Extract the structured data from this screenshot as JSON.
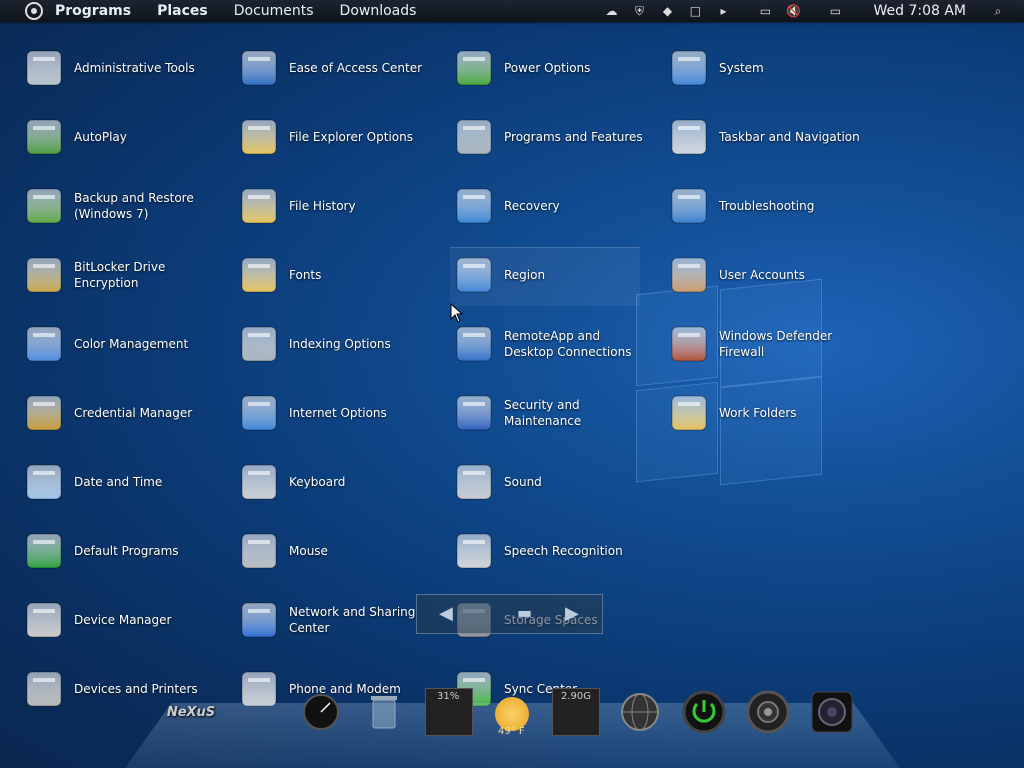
{
  "topbar": {
    "menus": [
      "Programs",
      "Places",
      "Documents",
      "Downloads"
    ],
    "clock": "Wed 7:08 AM"
  },
  "items": [
    {
      "label": "Administrative Tools",
      "icon": "admin-tools-icon"
    },
    {
      "label": "AutoPlay",
      "icon": "autoplay-icon"
    },
    {
      "label": "Backup and Restore\n(Windows 7)",
      "icon": "backup-restore-icon"
    },
    {
      "label": "BitLocker Drive\nEncryption",
      "icon": "bitlocker-icon"
    },
    {
      "label": "Color Management",
      "icon": "color-management-icon"
    },
    {
      "label": "Credential Manager",
      "icon": "credential-manager-icon"
    },
    {
      "label": "Date and Time",
      "icon": "date-time-icon"
    },
    {
      "label": "Default Programs",
      "icon": "default-programs-icon"
    },
    {
      "label": "Device Manager",
      "icon": "device-manager-icon"
    },
    {
      "label": "Devices and Printers",
      "icon": "devices-printers-icon"
    },
    {
      "label": "Ease of Access Center",
      "icon": "ease-of-access-icon"
    },
    {
      "label": "File Explorer Options",
      "icon": "file-explorer-options-icon"
    },
    {
      "label": "File History",
      "icon": "file-history-icon"
    },
    {
      "label": "Fonts",
      "icon": "fonts-icon"
    },
    {
      "label": "Indexing Options",
      "icon": "indexing-options-icon"
    },
    {
      "label": "Internet Options",
      "icon": "internet-options-icon"
    },
    {
      "label": "Keyboard",
      "icon": "keyboard-icon"
    },
    {
      "label": "Mouse",
      "icon": "mouse-icon"
    },
    {
      "label": "Network and Sharing\nCenter",
      "icon": "network-sharing-icon"
    },
    {
      "label": "Phone and Modem",
      "icon": "phone-modem-icon"
    },
    {
      "label": "Power Options",
      "icon": "power-options-icon"
    },
    {
      "label": "Programs and Features",
      "icon": "programs-features-icon"
    },
    {
      "label": "Recovery",
      "icon": "recovery-icon"
    },
    {
      "label": "Region",
      "icon": "region-icon"
    },
    {
      "label": "RemoteApp and\nDesktop Connections",
      "icon": "remoteapp-icon"
    },
    {
      "label": "Security and\nMaintenance",
      "icon": "security-maintenance-icon"
    },
    {
      "label": "Sound",
      "icon": "sound-icon"
    },
    {
      "label": "Speech Recognition",
      "icon": "speech-recognition-icon"
    },
    {
      "label": "Storage Spaces",
      "icon": "storage-spaces-icon"
    },
    {
      "label": "Sync Center",
      "icon": "sync-center-icon"
    },
    {
      "label": "System",
      "icon": "system-icon"
    },
    {
      "label": "Taskbar and Navigation",
      "icon": "taskbar-navigation-icon"
    },
    {
      "label": "Troubleshooting",
      "icon": "troubleshooting-icon"
    },
    {
      "label": "User Accounts",
      "icon": "user-accounts-icon"
    },
    {
      "label": "Windows Defender\nFirewall",
      "icon": "firewall-icon"
    },
    {
      "label": "Work Folders",
      "icon": "work-folders-icon"
    }
  ],
  "dock": {
    "nexus_label": "NeXuS",
    "cpu_label": "31%",
    "weather_label": "49° F",
    "disk_label": "2.90G"
  }
}
